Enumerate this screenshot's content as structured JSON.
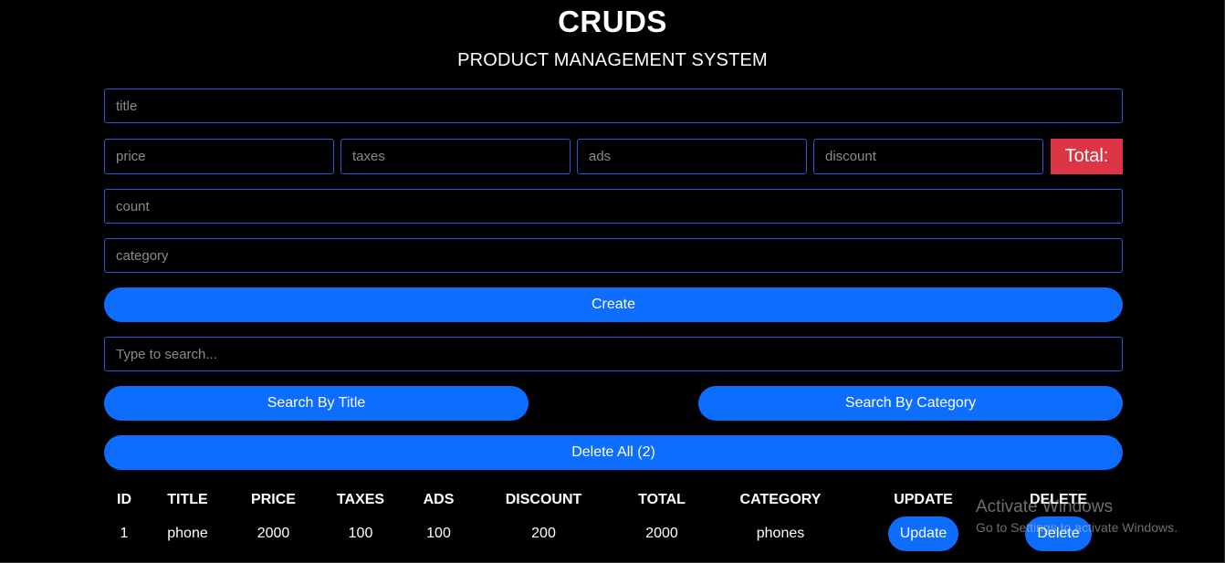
{
  "header": {
    "title": "CRUDS",
    "subtitle": "PRODUCT MANAGEMENT SYSTEM"
  },
  "form": {
    "title_placeholder": "title",
    "price_placeholder": "price",
    "taxes_placeholder": "taxes",
    "ads_placeholder": "ads",
    "discount_placeholder": "discount",
    "total_label": "Total:",
    "count_placeholder": "count",
    "category_placeholder": "category",
    "create_label": "Create"
  },
  "search": {
    "placeholder": "Type to search...",
    "by_title_label": "Search By Title",
    "by_category_label": "Search By Category",
    "delete_all_label": "Delete All (2)"
  },
  "table": {
    "headers": [
      "ID",
      "TITLE",
      "PRICE",
      "TAXES",
      "ADS",
      "DISCOUNT",
      "TOTAL",
      "CATEGORY",
      "UPDATE",
      "DELETE"
    ],
    "rows": [
      {
        "id": "1",
        "title": "phone",
        "price": "2000",
        "taxes": "100",
        "ads": "100",
        "discount": "200",
        "total": "2000",
        "category": "phones",
        "update_label": "Update",
        "delete_label": "Delete"
      }
    ]
  },
  "watermark": {
    "title": "Activate Windows",
    "subtitle": "Go to Settings to activate Windows."
  },
  "colors": {
    "background": "#000000",
    "primary": "#0d6efd",
    "danger": "#dc3545",
    "input_border": "#2f55d4"
  }
}
